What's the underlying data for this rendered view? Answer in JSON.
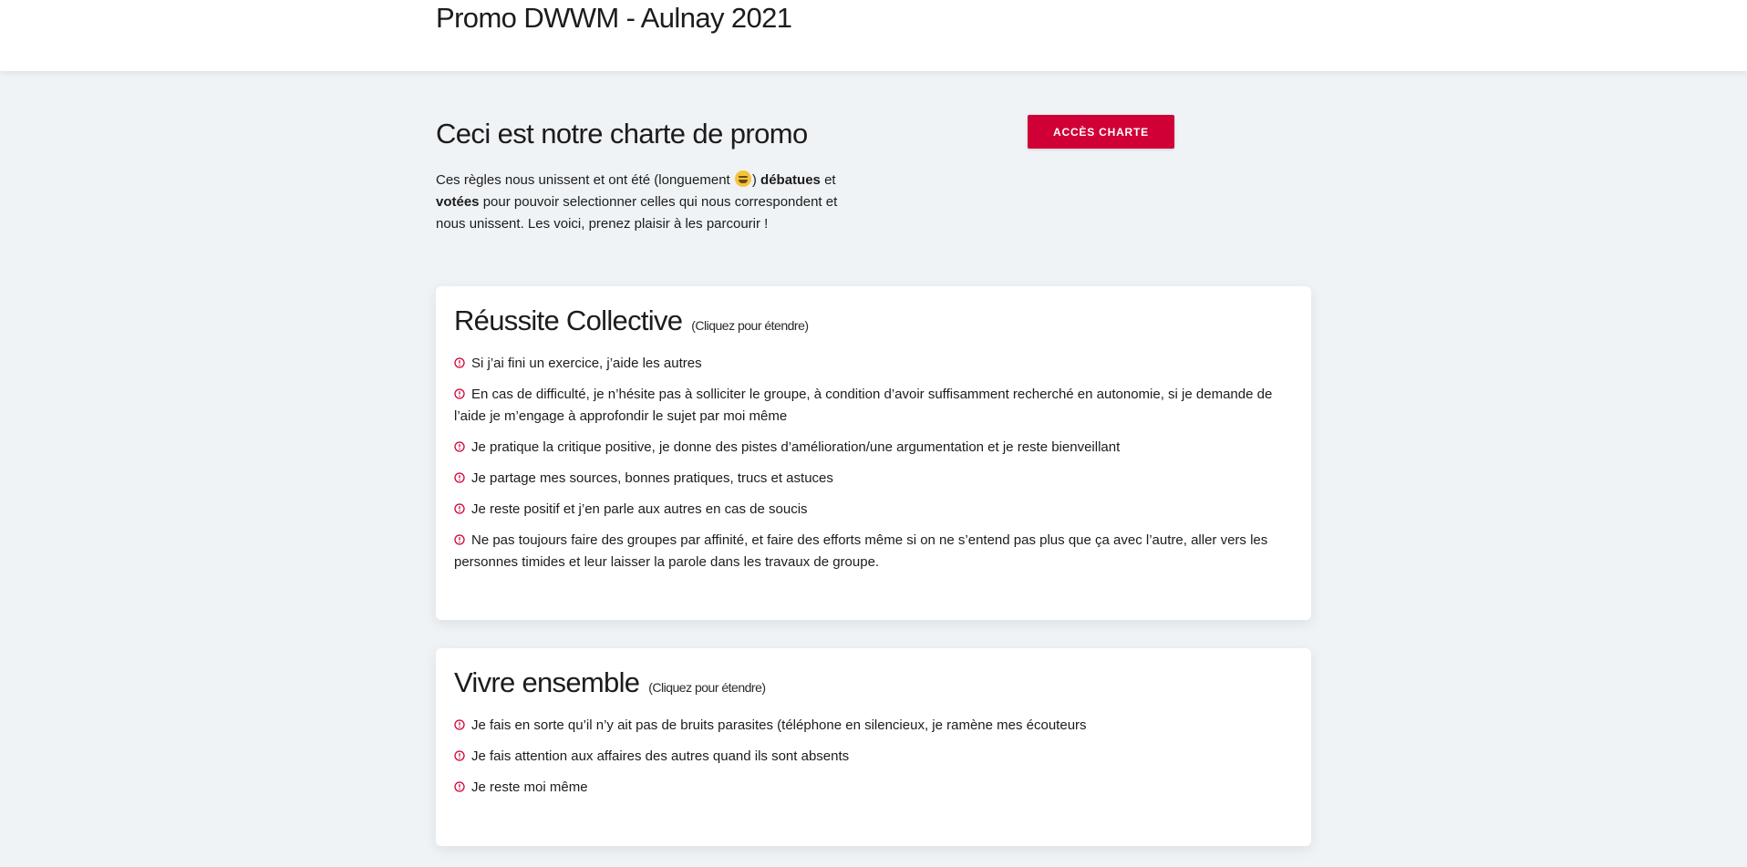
{
  "header": {
    "title": "Promo DWWM - Aulnay 2021"
  },
  "intro": {
    "heading": "Ceci est notre charte de promo",
    "text_part1": "Ces règles nous unissent et ont été (longuement ",
    "text_part2": ") ",
    "bold1": "débatues",
    "text_part3": " et ",
    "bold2": "votées",
    "text_part4": " pour pouvoir selectionner celles qui nous correspondent et nous unissent. Les voici, prenez plaisir à les parcourir !",
    "emoji_icon": "grinning-sweat-emoji"
  },
  "cta": {
    "label": "ACCÈS CHARTE",
    "color": "#d00037"
  },
  "sections": [
    {
      "title": "Réussite Collective",
      "hint": "(Cliquez pour étendre)",
      "rules": [
        "Si j’ai fini un exercice, j’aide les autres",
        "En cas de difficulté, je n’hésite pas à solliciter le groupe, à condition d’avoir suffisamment recherché en autonomie, si je demande de l’aide je m’engage à approfondir le sujet par moi même",
        "Je pratique la critique positive, je donne des pistes d’amélioration/une argumentation et je reste bienveillant",
        "Je partage mes sources, bonnes pratiques, trucs et astuces",
        "Je reste positif et j’en parle aux autres en cas de soucis",
        "Ne pas toujours faire des groupes par affinité, et faire des efforts même si on ne s’entend pas plus que ça avec l’autre, aller vers les personnes timides et leur laisser la parole dans les travaux de groupe."
      ]
    },
    {
      "title": "Vivre ensemble",
      "hint": "(Cliquez pour étendre)",
      "rules": [
        "Je fais en sorte qu’il n’y ait pas de bruits parasites (téléphone en silencieux, je ramène mes écouteurs",
        "Je fais attention aux affaires des autres quand ils sont absents",
        "Je reste moi même"
      ]
    }
  ],
  "icons": {
    "rule_icon": "alert-circle-icon",
    "rule_icon_color": "#d00037"
  }
}
